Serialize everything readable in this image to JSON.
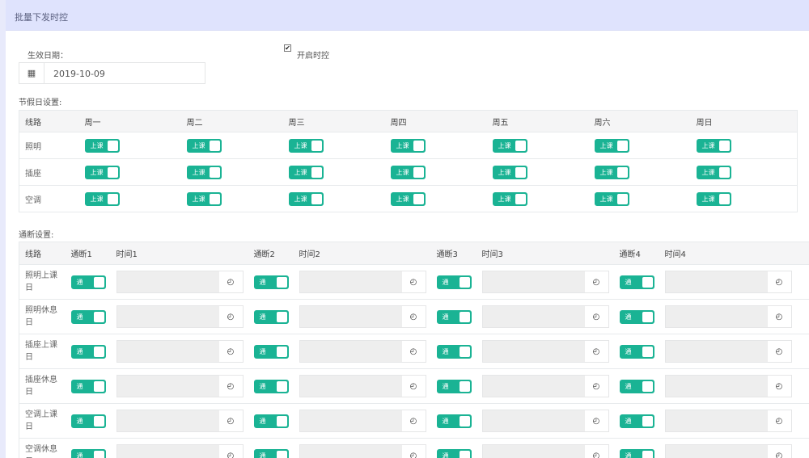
{
  "title": "批量下发时控",
  "effective_date_label": "生效日期：",
  "effective_date": "2019-10-09",
  "enable_label": "开启时控",
  "enable_checked": true,
  "holiday_label": "节假日设置:",
  "holiday_headers": [
    "线路",
    "周一",
    "周二",
    "周三",
    "周四",
    "周五",
    "周六",
    "周日"
  ],
  "holiday_rows": [
    "照明",
    "插座",
    "空调"
  ],
  "holiday_toggle": "上课",
  "switch_label": "通断设置:",
  "switch_headers": [
    "线路",
    "通断1",
    "时间1",
    "通断2",
    "时间2",
    "通断3",
    "时间3",
    "通断4",
    "时间4"
  ],
  "switch_rows": [
    "照明上课日",
    "照明休息日",
    "插座上课日",
    "插座休息日",
    "空调上课日",
    "空调休息日"
  ],
  "switch_toggle": "通",
  "accent": "#1ab394",
  "icons": {
    "calendar": "calendar-icon",
    "clock": "clock-icon"
  }
}
